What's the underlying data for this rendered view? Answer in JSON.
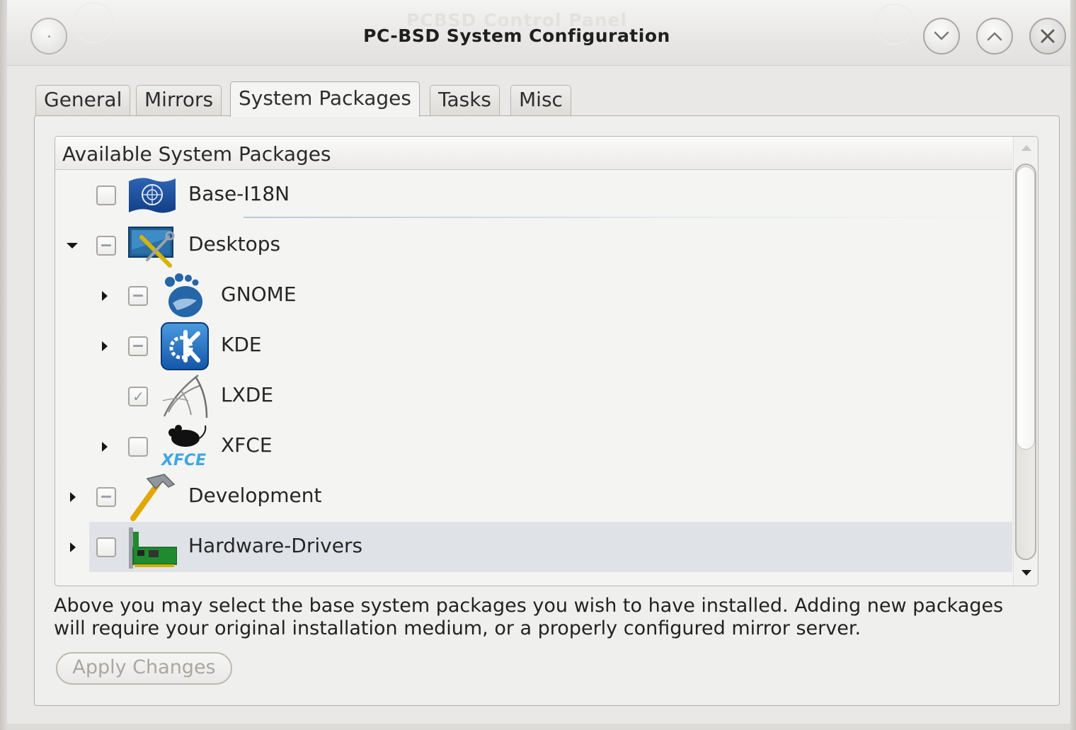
{
  "window": {
    "app_title": "PCBSD Control Panel",
    "title": "PC-BSD System Configuration",
    "buttons": {
      "minimize_icon": "chevron-down-icon",
      "maximize_icon": "chevron-up-icon",
      "close_icon": "close-icon"
    }
  },
  "tabs": [
    {
      "label": "General"
    },
    {
      "label": "Mirrors"
    },
    {
      "label": "System Packages",
      "active": true
    },
    {
      "label": "Tasks"
    },
    {
      "label": "Misc"
    }
  ],
  "tree": {
    "header": "Available System Packages",
    "rows": [
      {
        "label": "Base-I18N",
        "state": "unchecked",
        "icon": "flag-icon"
      },
      {
        "label": "Desktops",
        "state": "partial",
        "expanded": true,
        "icon": "desktop-tools-icon"
      },
      {
        "label": "GNOME",
        "state": "partial",
        "icon": "gnome-foot-icon"
      },
      {
        "label": "KDE",
        "state": "partial",
        "icon": "kde-gear-icon"
      },
      {
        "label": "LXDE",
        "state": "checked",
        "icon": "lxde-icon"
      },
      {
        "label": "XFCE",
        "state": "unchecked",
        "icon": "xfce-mouse-icon"
      },
      {
        "label": "Development",
        "state": "partial",
        "icon": "hammer-icon"
      },
      {
        "label": "Hardware-Drivers",
        "state": "unchecked",
        "selected": true,
        "icon": "pci-card-icon"
      }
    ]
  },
  "description": "Above you may select the base system packages you wish to have installed. Adding new packages will require your original installation medium, or a properly configured mirror server.",
  "apply_button": "Apply Changes",
  "colors": {
    "selection": "#dfe3e8",
    "panel": "#efefed"
  }
}
